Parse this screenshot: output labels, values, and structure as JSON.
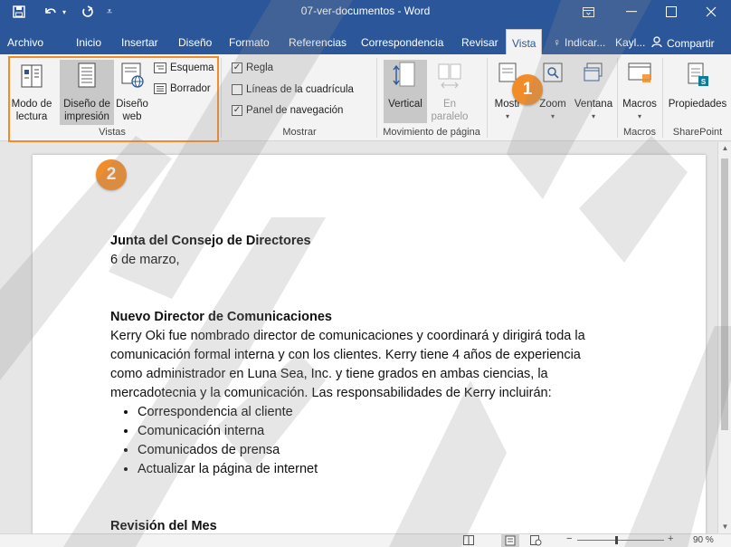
{
  "window": {
    "title": "07-ver-documentos  -  Word"
  },
  "tabs": [
    "Archivo",
    "Inicio",
    "Insertar",
    "Diseño",
    "Formato",
    "Referencias",
    "Correspondencia",
    "Revisar",
    "Vista"
  ],
  "tabs_right": {
    "search_label": "Indicar...",
    "user": "Kayl...",
    "share": "Compartir"
  },
  "ribbon": {
    "vistas": {
      "read_mode": [
        "Modo de",
        "lectura"
      ],
      "print_layout": [
        "Diseño de",
        "impresión"
      ],
      "web_layout": [
        "Diseño",
        "web"
      ],
      "outline": "Esquema",
      "draft": "Borrador",
      "label": "Vistas"
    },
    "mostrar": {
      "ruler": "Regla",
      "gridlines": "Líneas de la cuadrícula",
      "nav_pane": "Panel de navegación",
      "label": "Mostrar",
      "ruler_checked": true,
      "gridlines_checked": false,
      "nav_pane_checked": true
    },
    "movimiento": {
      "vertical": "Vertical",
      "side_by_side": [
        "En",
        "paralelo"
      ],
      "label": "Movimiento de página"
    },
    "mostrar_btn": "Mostr",
    "zoom": "Zoom",
    "ventana": "Ventana",
    "macros": "Macros",
    "macros_label": "Macros",
    "propiedades": "Propiedades",
    "sharepoint_label": "SharePoint"
  },
  "callouts": [
    "1",
    "2"
  ],
  "document": {
    "heading1": "Junta del Consejo de Directores",
    "date": "6 de marzo,",
    "heading2": "Nuevo Director de Comunicaciones",
    "para_lines": [
      "Kerry Oki fue nombrado director de comunicaciones y coordinará y dirigirá toda la",
      "comunicación formal interna y con los clientes. Kerry tiene 4 años de experiencia",
      "como administrador en Luna Sea, Inc. y tiene grados en ambas ciencias, la",
      "mercadotecnia y la comunicación. Las responsabilidades de Kerry incluirán:"
    ],
    "bullets": [
      "Correspondencia al cliente",
      "Comunicación interna",
      "Comunicados de prensa",
      "Actualizar la página de internet"
    ],
    "heading3": "Revisión del Mes"
  },
  "status": {
    "zoom": "90 %",
    "minus": "−",
    "plus": "+"
  },
  "colors": {
    "word_blue": "#2b579a",
    "callout_orange": "#f28c28"
  }
}
